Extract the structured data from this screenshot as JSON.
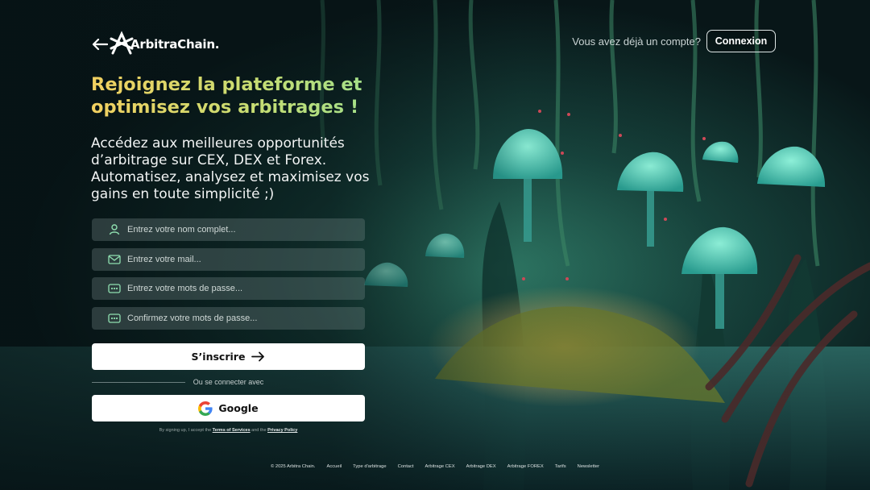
{
  "brand": {
    "name": "ArbitraChain.",
    "accent_gradient": [
      "#f2d060",
      "#9fe08c"
    ]
  },
  "header": {
    "have_account_text": "Vous avez déjà un compte?",
    "login_label": "Connexion",
    "back_icon": "arrow-left-icon"
  },
  "hero": {
    "headline": "Rejoignez la plateforme et optimisez vos arbitrages !",
    "intro": "Accédez aux meilleures opportunités d’arbitrage sur CEX, DEX et Forex. Automatisez, analysez et maximisez vos gains en toute simplicité ;)"
  },
  "form": {
    "fields": [
      {
        "placeholder": "Entrez votre nom complet...",
        "value": "",
        "icon": "user-icon"
      },
      {
        "placeholder": "Entrez votre mail...",
        "value": "",
        "icon": "mail-icon"
      },
      {
        "placeholder": "Entrez votre mots de passe...",
        "value": "",
        "icon": "password-icon"
      },
      {
        "placeholder": "Confirmez votre mots de passe...",
        "value": "",
        "icon": "password-icon"
      }
    ],
    "submit_label": "S’inscrire",
    "submit_icon": "arrow-right-icon",
    "divider_text": "Ou se connecter avec",
    "google_label": "Google",
    "google_icon": "google-icon",
    "terms_prefix": "By signing up, I accept the",
    "terms_link": "Terms of Services",
    "terms_and": "and the",
    "privacy_link": "Privacy Policy"
  },
  "footer": {
    "copyright": "© 2025 Arbitra Chain.",
    "links": [
      "Accueil",
      "Type d'arbitrage",
      "Contact",
      "Arbitrage CEX",
      "Arbitrage DEX",
      "Arbitrage FOREX",
      "Tarifs",
      "Newsletter"
    ]
  }
}
